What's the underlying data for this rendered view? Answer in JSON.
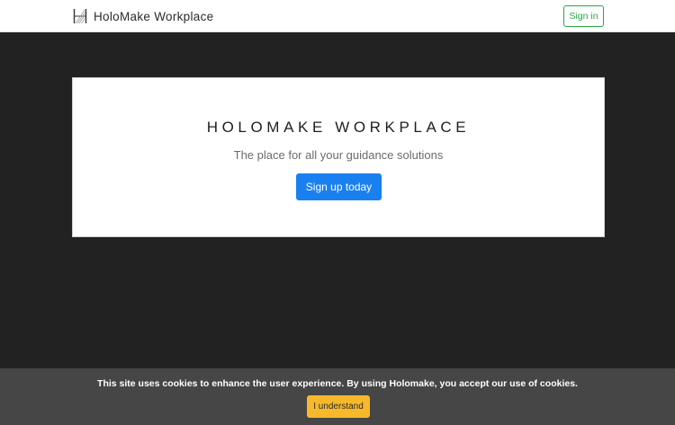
{
  "navbar": {
    "brand_name": "HoloMake Workplace",
    "brand_logo_icon": "holomake-h-logo-icon",
    "signin_label": "Sign in"
  },
  "hero": {
    "title": "HOLOMAKE WORKPLACE",
    "subtitle": "The place for all your guidance solutions",
    "cta_label": "Sign up today"
  },
  "cookie": {
    "message": "This site uses cookies to enhance the user experience. By using Holomake, you accept our use of cookies.",
    "accept_label": "I understand"
  },
  "colors": {
    "page_background": "#222222",
    "signin_accent": "#28a745",
    "cta_background": "#1a80f0",
    "cookie_bar_background": "#464646",
    "cookie_button_background": "#f6b92c"
  }
}
